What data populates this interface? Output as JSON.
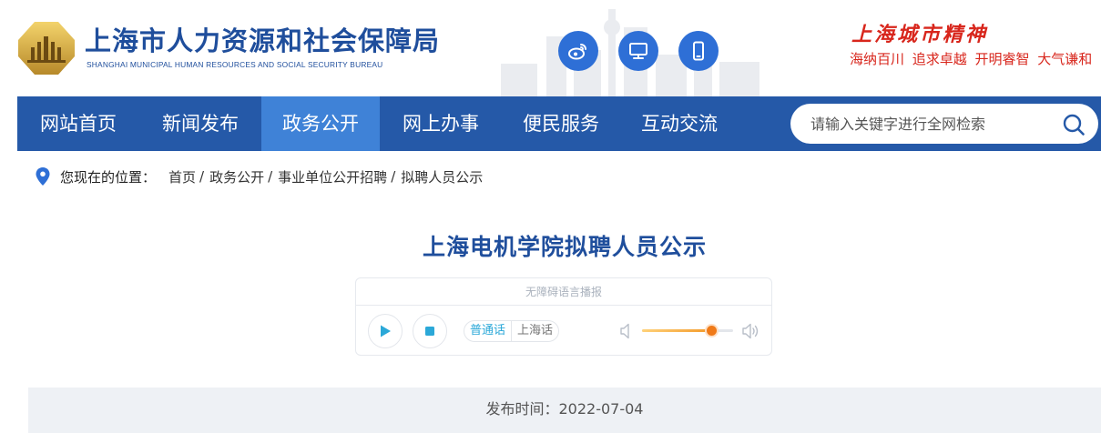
{
  "header": {
    "site_name": "上海市人力资源和社会保障局",
    "site_name_en": "SHANGHAI MUNICIPAL HUMAN RESOURCES AND SOCIAL SECURITY BUREAU",
    "social": [
      {
        "icon": "weibo-icon"
      },
      {
        "icon": "desktop-icon"
      },
      {
        "icon": "mobile-icon"
      }
    ],
    "spirit_title": "上海城市精神",
    "spirit_sub": "海纳百川 追求卓越 开明睿智 大气谦和"
  },
  "nav": {
    "items": [
      {
        "label": "网站首页"
      },
      {
        "label": "新闻发布"
      },
      {
        "label": "政务公开",
        "active": true
      },
      {
        "label": "网上办事"
      },
      {
        "label": "便民服务"
      },
      {
        "label": "互动交流"
      }
    ],
    "search_placeholder": "请输入关键字进行全网检索"
  },
  "breadcrumb": {
    "label": "您现在的位置：",
    "items": [
      "首页",
      "政务公开",
      "事业单位公开招聘",
      "拟聘人员公示"
    ]
  },
  "article": {
    "title": "上海电机学院拟聘人员公示",
    "publish_label": "发布时间：2022-07-04"
  },
  "player": {
    "header": "无障碍语言播报",
    "lang_options": [
      "普通话",
      "上海话"
    ],
    "selected_lang": "普通话",
    "volume": 0.76
  },
  "colors": {
    "brand_blue": "#1f4e9c",
    "nav_bg": "#2559a8",
    "nav_active": "#3f82d7",
    "social_bg": "#2e6fd6",
    "spirit_red": "#d8261c",
    "player_accent": "#2ba8d8",
    "volume_orange": "#f07a18"
  }
}
